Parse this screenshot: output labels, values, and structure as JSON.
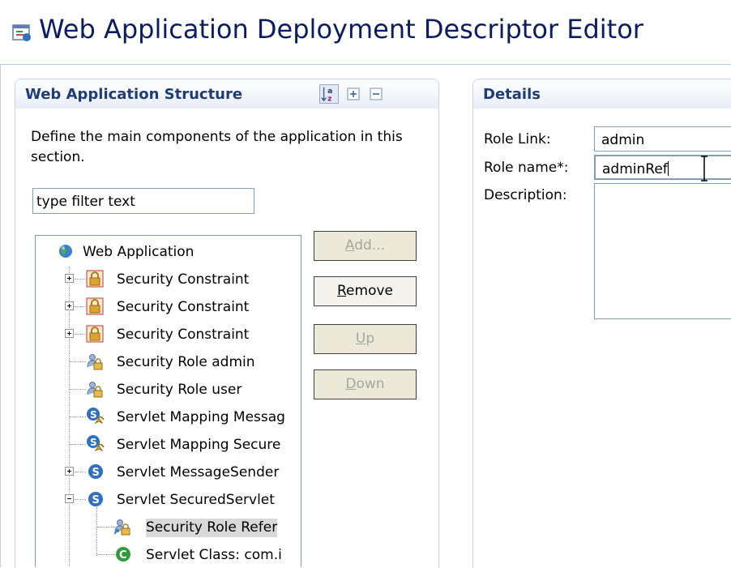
{
  "editor": {
    "title": "Web Application Deployment Descriptor Editor"
  },
  "structure": {
    "title": "Web Application Structure",
    "description": "Define the main components of the application in this section.",
    "filter_placeholder": "type filter text",
    "tree": [
      {
        "label": "Web Application",
        "icon": "web-app-globe-icon"
      },
      {
        "label": "Security Constraint",
        "icon": "lock-icon"
      },
      {
        "label": "Security Constraint",
        "icon": "lock-icon"
      },
      {
        "label": "Security Constraint",
        "icon": "lock-icon"
      },
      {
        "label": "Security Role admin",
        "icon": "security-role-icon"
      },
      {
        "label": "Security Role user",
        "icon": "security-role-icon"
      },
      {
        "label": "Servlet Mapping Messag",
        "icon": "servlet-mapping-icon"
      },
      {
        "label": "Servlet Mapping Secure",
        "icon": "servlet-mapping-icon"
      },
      {
        "label": "Servlet MessageSender",
        "icon": "servlet-icon"
      },
      {
        "label": "Servlet SecuredServlet",
        "icon": "servlet-icon"
      },
      {
        "label": "Security Role Refer",
        "icon": "security-role-ref-icon"
      },
      {
        "label": "Servlet Class: com.i",
        "icon": "servlet-class-icon"
      }
    ],
    "buttons": {
      "add_pre": "",
      "add_mn": "A",
      "add_post": "dd...",
      "remove_pre": "",
      "remove_mn": "R",
      "remove_post": "emove",
      "up_pre": "",
      "up_mn": "U",
      "up_post": "p",
      "down_pre": "",
      "down_mn": "D",
      "down_post": "own"
    }
  },
  "details": {
    "title": "Details",
    "role_link_label": "Role Link:",
    "role_link_value": "admin",
    "role_name_label": "Role name*:",
    "role_name_value": "adminRef",
    "description_label": "Description:"
  },
  "colors": {
    "title_text": "#0a1c64",
    "section_title": "#1e3c78",
    "lock": "#c89a1e",
    "servlet": "#2f6fc4",
    "servlet_class": "#2e9b3e"
  }
}
